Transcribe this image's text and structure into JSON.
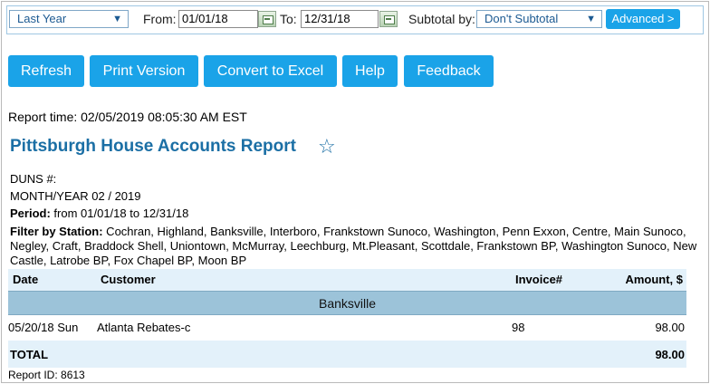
{
  "filters": {
    "period_select": "Last Year",
    "from_label": "From:",
    "from_value": "01/01/18",
    "to_label": "To:",
    "to_value": "12/31/18",
    "subtotal_label": "Subtotal by:",
    "subtotal_select": "Don't Subtotal",
    "advanced_label": "Advanced >"
  },
  "actions": {
    "refresh": "Refresh",
    "print": "Print Version",
    "excel": "Convert to Excel",
    "help": "Help",
    "feedback": "Feedback"
  },
  "report": {
    "time": "Report time: 02/05/2019 08:05:30 AM EST",
    "title": "Pittsburgh House Accounts Report",
    "star": "☆",
    "duns": "DUNS #:",
    "month_year": "MONTH/YEAR 02 / 2019",
    "period_label": "Period:",
    "period_value": " from 01/01/18 to 12/31/18",
    "filter_label": "Filter by Station:",
    "filter_value": " Cochran, Highland, Banksville, Interboro, Frankstown Sunoco, Washington, Penn Exxon, Centre, Main Sunoco, Negley, Craft, Braddock Shell, Uniontown, McMurray, Leechburg, Mt.Pleasant, Scottdale, Frankstown BP, Washington Sunoco, New Castle, Latrobe BP, Fox Chapel BP, Moon BP",
    "report_id": "Report ID: 8613"
  },
  "table": {
    "headers": {
      "date": "Date",
      "customer": "Customer",
      "invoice": "Invoice#",
      "amount": "Amount, $"
    },
    "group": "Banksville",
    "rows": [
      {
        "date": "05/20/18 Sun",
        "customer": "Atlanta Rebates-c",
        "invoice": "98",
        "amount": "98.00"
      }
    ],
    "total_label": "TOTAL",
    "total_amount": "98.00"
  }
}
